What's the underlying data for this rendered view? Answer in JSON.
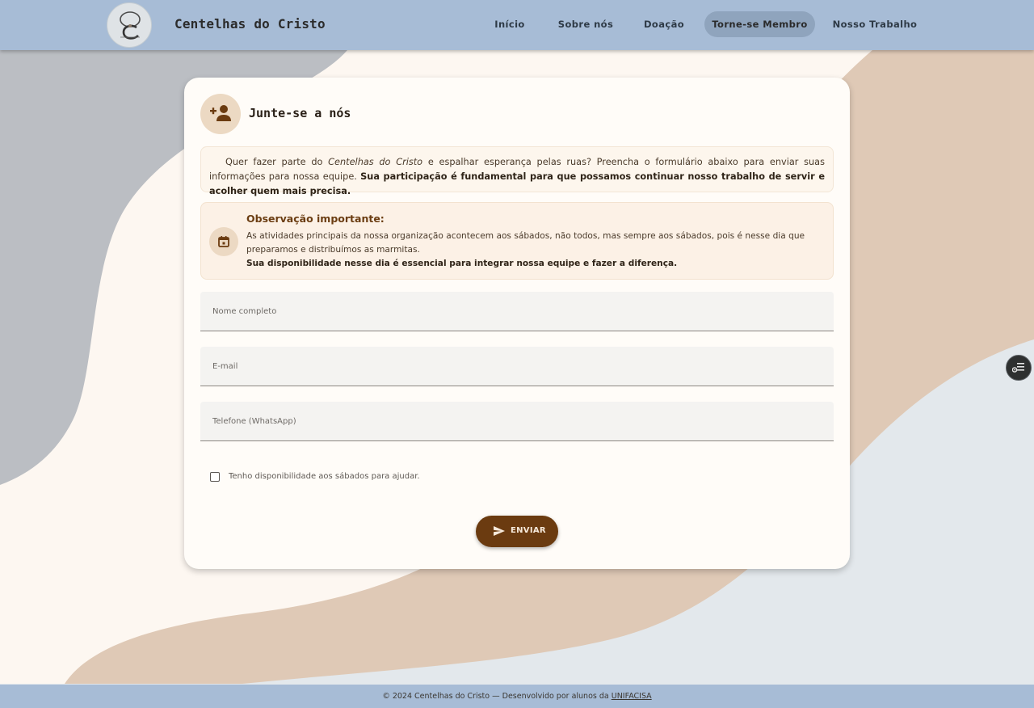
{
  "header": {
    "brand": "Centelhas do Cristo",
    "logo_alt": "Centelhas do Cristo logo",
    "nav": [
      {
        "label": "Início"
      },
      {
        "label": "Sobre nós"
      },
      {
        "label": "Doação"
      },
      {
        "label": "Torne-se Membro",
        "active": true
      },
      {
        "label": "Nosso Trabalho"
      }
    ]
  },
  "card": {
    "icon": "person-add-icon",
    "title": "Junte-se a nós",
    "intro": {
      "part1": "Quer fazer parte do ",
      "em": "Centelhas do Cristo",
      "part2": " e espalhar esperança pelas ruas? Preencha o formulário abaixo para enviar suas informações para nossa equipe. ",
      "strong": "Sua participação é fundamental para que possamos continuar nosso trabalho de servir e acolher quem mais precisa."
    },
    "note": {
      "icon": "calendar-icon",
      "title": "Observação importante:",
      "body": "As atividades principais da nossa organização acontecem aos sábados, não todos, mas sempre aos sábados, pois é nesse dia que preparamos e distribuímos as marmitas.",
      "strong": "Sua disponibilidade nesse dia é essencial para integrar nossa equipe e fazer a diferença."
    },
    "form": {
      "name_placeholder": "Nome completo",
      "email_placeholder": "E-mail",
      "phone_placeholder": "Telefone (WhatsApp)",
      "checkbox_label": "Tenho disponibilidade aos sábados para ajudar.",
      "checkbox_checked": false,
      "submit_label": "ENVIAR",
      "submit_icon": "send-icon"
    }
  },
  "floating_button": {
    "icon": "accessibility-icon"
  },
  "footer": {
    "text": "© 2024 Centelhas do Cristo — Desenvolvido por alunos da ",
    "link": "UNIFACISA"
  },
  "colors": {
    "header_bg": "#a7bcd6",
    "accent_brown": "#6b3b10",
    "card_bg": "#fffcf8",
    "active_nav_bg": "#8fa4bd"
  }
}
